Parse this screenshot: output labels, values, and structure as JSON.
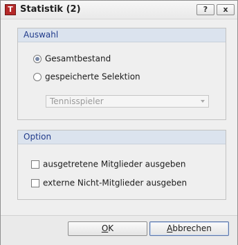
{
  "window": {
    "title": "Statistik (2)",
    "icon": "app-logo-icon",
    "help_label": "?",
    "close_label": "x"
  },
  "auswahl": {
    "header": "Auswahl",
    "option_total": "Gesamtbestand",
    "option_saved": "gespeicherte Selektion",
    "selected": "Gesamtbestand",
    "combo_value": "Tennisspieler"
  },
  "option": {
    "header": "Option",
    "check1": "ausgetretene Mitglieder ausgeben",
    "check2": "externe Nicht-Mitglieder ausgeben"
  },
  "buttons": {
    "ok_first": "O",
    "ok_rest": "K",
    "cancel_first": "A",
    "cancel_rest": "bbrechen"
  }
}
